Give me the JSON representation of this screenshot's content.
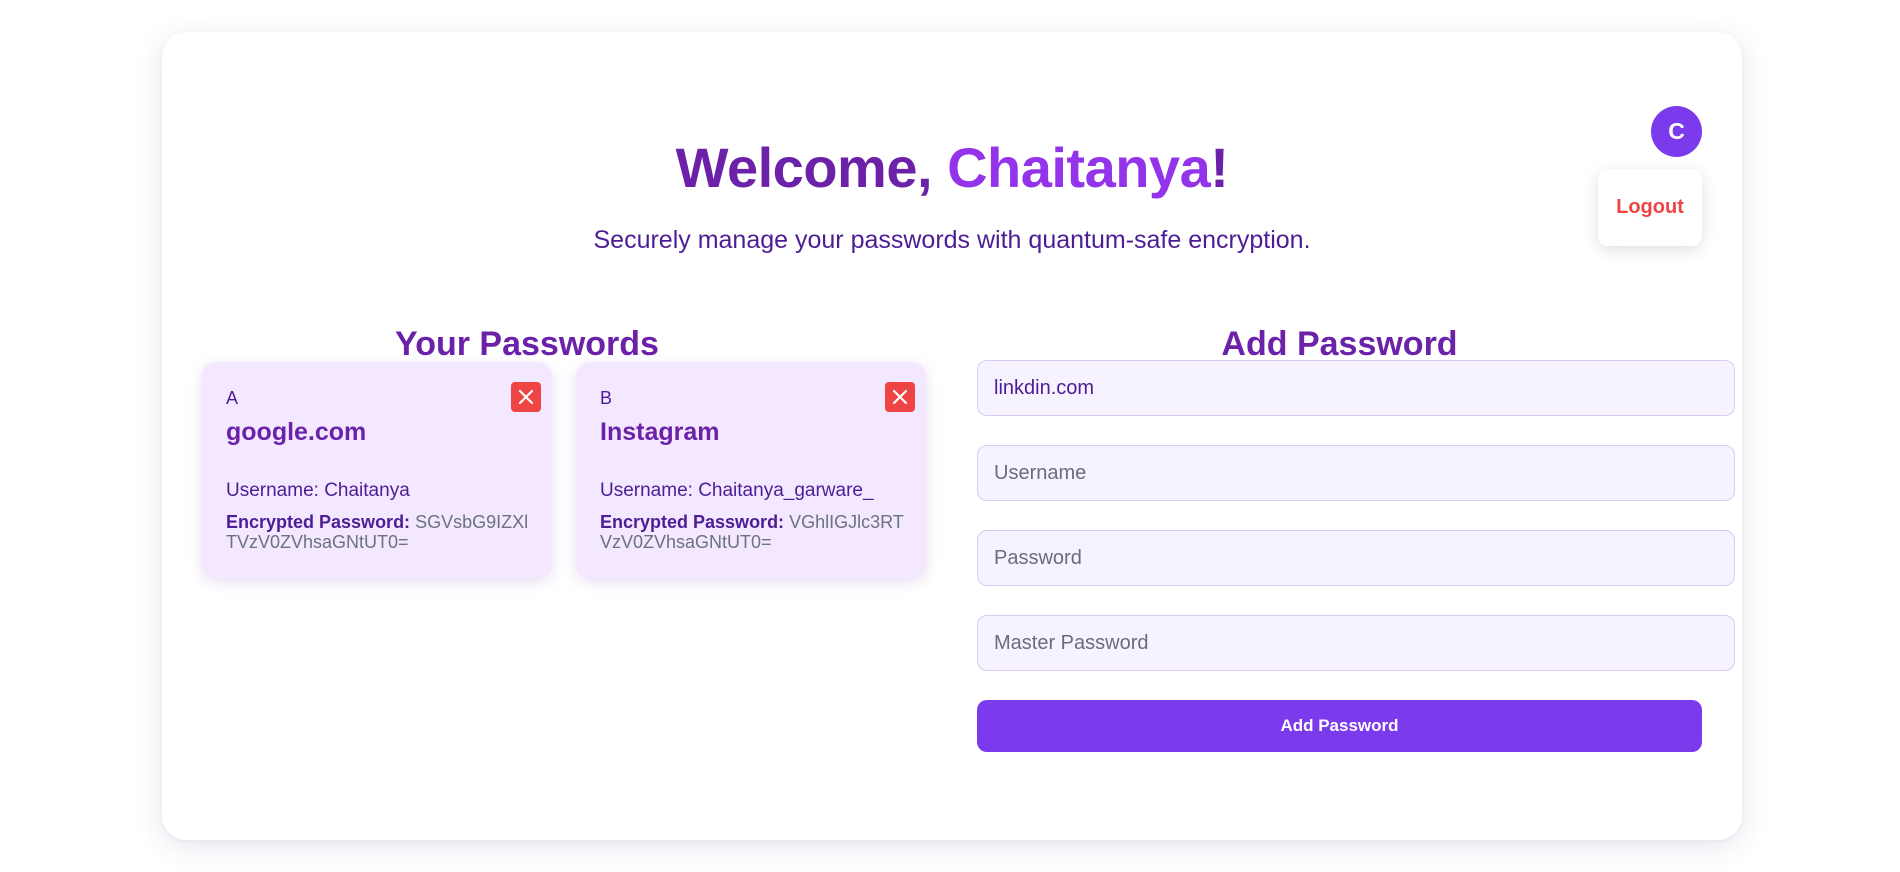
{
  "header": {
    "welcome_prefix": "Welcome, ",
    "user_name": "Chaitanya",
    "welcome_suffix": "!",
    "subtitle": "Securely manage your passwords with quantum-safe encryption."
  },
  "user_menu": {
    "avatar_initial": "C",
    "logout_label": "Logout"
  },
  "passwords_section": {
    "title": "Your Passwords",
    "encrypted_label": "Encrypted Password:",
    "items": [
      {
        "letter": "A",
        "site": "google.com",
        "username_text": "Username: Chaitanya",
        "encrypted_value": "SGVsbG9IZXlTVzV0ZVhsaGNtUT0="
      },
      {
        "letter": "B",
        "site": "Instagram",
        "username_text": "Username: Chaitanya_garware_",
        "encrypted_value": "VGhlIGJlc3RTVzV0ZVhsaGNtUT0="
      }
    ]
  },
  "add_section": {
    "title": "Add Password",
    "website_value": "linkdin.com",
    "username_placeholder": "Username",
    "password_placeholder": "Password",
    "master_password_placeholder": "Master Password",
    "submit_label": "Add Password"
  },
  "colors": {
    "primary": "#7c3aed",
    "heading": "#6b21a8",
    "accent_name": "#9333ea",
    "danger": "#ef4444",
    "card_bg": "#f3e8ff"
  },
  "icons": {
    "delete": "close-icon"
  }
}
